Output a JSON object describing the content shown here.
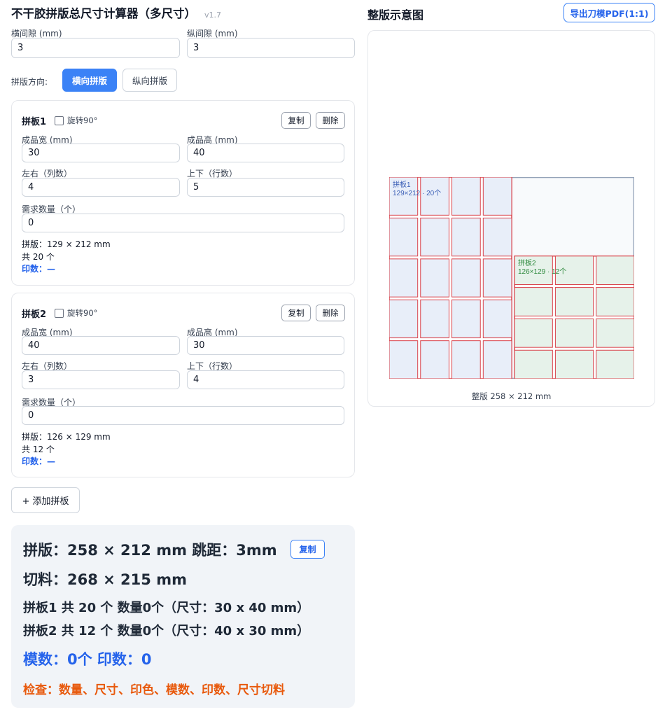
{
  "app": {
    "title": "不干胶拼版总尺寸计算器（多尺寸）",
    "version": "v1.7"
  },
  "gaps": {
    "h_label": "横间隙 (mm)",
    "h_value": "3",
    "v_label": "纵间隙 (mm)",
    "v_value": "3"
  },
  "direction": {
    "label": "拼版方向:",
    "options": [
      "横向拼版",
      "纵向拼版"
    ],
    "selected": "横向拼版"
  },
  "labels": {
    "rotate": "旋转90°",
    "copy": "复制",
    "delete": "删除",
    "width": "成品宽 (mm)",
    "height": "成品高 (mm)",
    "cols": "左右（列数）",
    "rows": "上下（行数）",
    "qty": "需求数量（个）"
  },
  "boards": [
    {
      "name": "拼板1",
      "width": "30",
      "height": "40",
      "cols": "4",
      "rows": "5",
      "qty": "0",
      "size_text": "拼版：129 × 212 mm",
      "count_text": "共 20 个",
      "print_text": "印数：—",
      "preview_label": "拼板1",
      "preview_sub": "129×212 · 20个"
    },
    {
      "name": "拼板2",
      "width": "40",
      "height": "30",
      "cols": "3",
      "rows": "4",
      "qty": "0",
      "size_text": "拼版：126 × 129 mm",
      "count_text": "共 12 个",
      "print_text": "印数：—",
      "preview_label": "拼板2",
      "preview_sub": "126×129 · 12个"
    }
  ],
  "add_button": "+ 添加拼板",
  "summary": {
    "layout": "拼版：258 × 212 mm 跳距：3mm",
    "copy": "复制",
    "cut": "切料：268 × 215 mm",
    "board1": "拼板1 共 20 个 数量0个（尺寸：30 x 40 mm）",
    "board2": "拼板2 共 12 个 数量0个（尺寸：40 x 30 mm）",
    "mold": "模数：0个 印数：0",
    "check": "检查：数量、尺寸、印色、模数、印数、尺寸切料"
  },
  "preview": {
    "title": "整版示意图",
    "export": "导出刀模PDF(1:1)",
    "caption": "整版 258 × 212 mm",
    "sheet_mm": [
      258,
      212
    ],
    "gap_mm": 3
  },
  "colors": {
    "accent": "#3b82f6",
    "cell_border": "#d9434b",
    "board1_fill": "#e8eef9",
    "board2_fill": "#e6f2ea",
    "board1_text": "#3b5fb6",
    "board2_text": "#2f8a3e",
    "summary_blue": "#2563eb",
    "summary_orange": "#e8590c"
  },
  "icons": {
    "checkbox": "checkbox-icon"
  }
}
